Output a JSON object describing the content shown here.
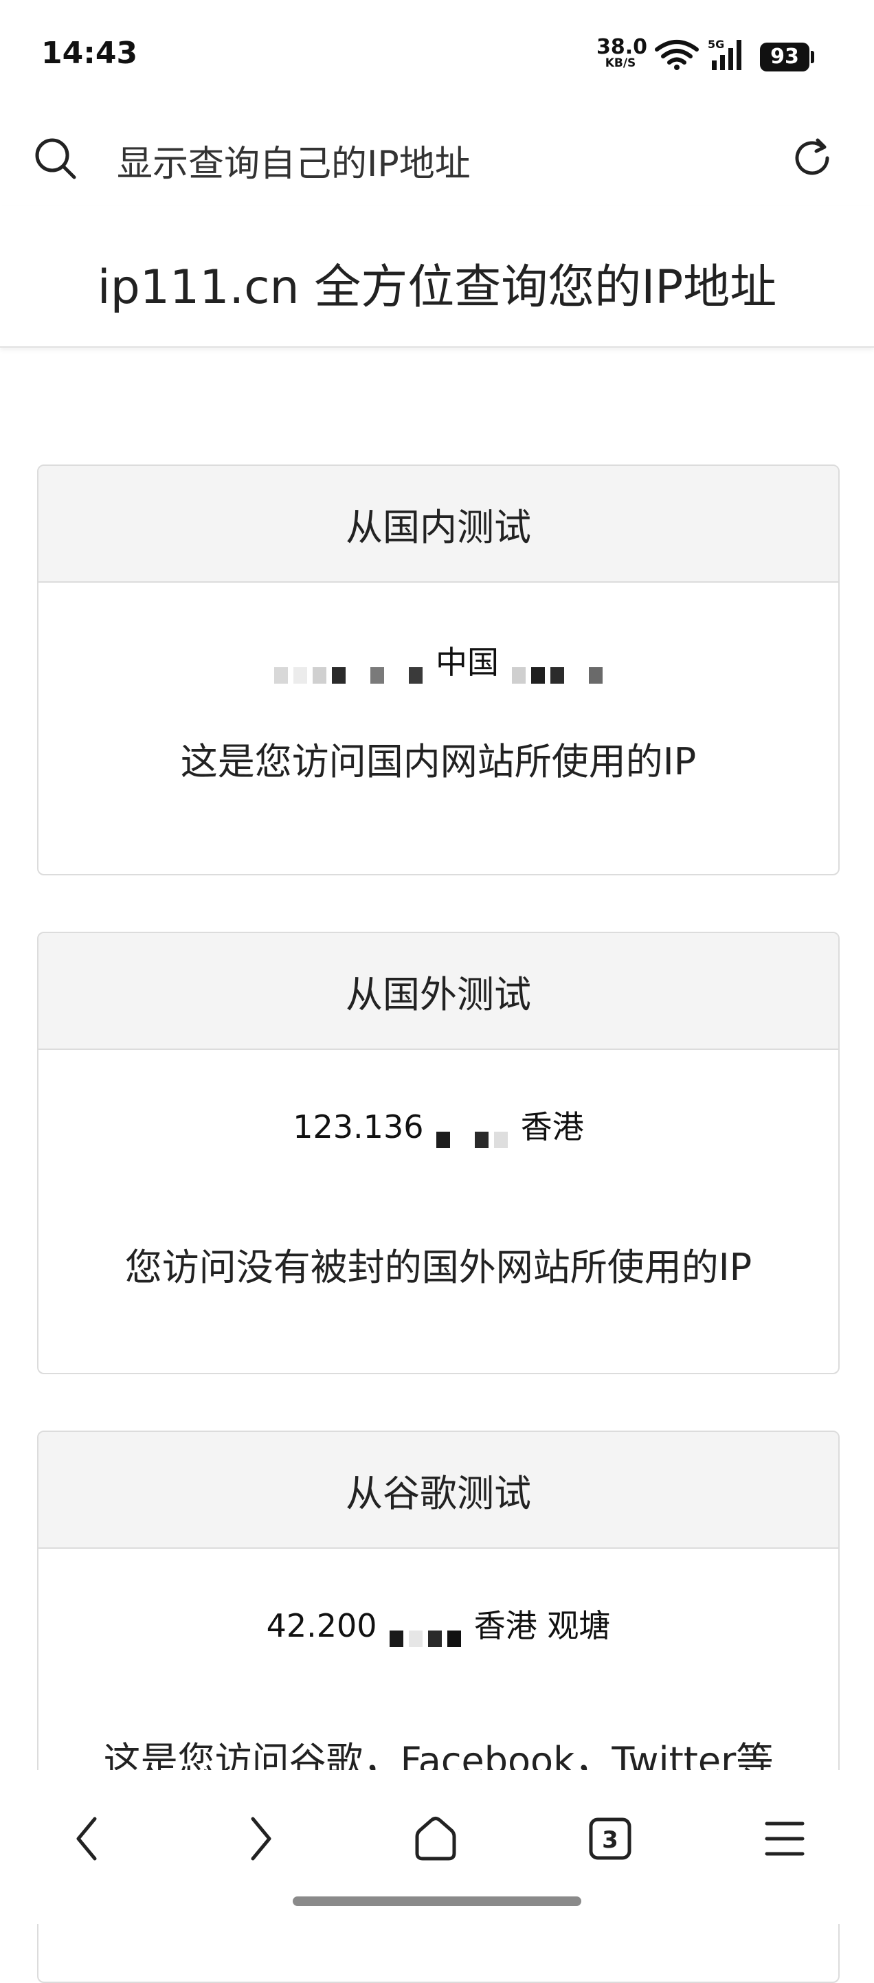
{
  "status_bar": {
    "time": "14:43",
    "net_speed_value": "38.0",
    "net_speed_unit": "KB/S",
    "network_type": "5G",
    "battery": "93"
  },
  "search": {
    "query": "显示查询自己的IP地址"
  },
  "header": {
    "title": "ip111.cn 全方位查询您的IP地址"
  },
  "cards": [
    {
      "title": "从国内测试",
      "ip_visible_text": "中国",
      "description": "这是您访问国内网站所使用的IP"
    },
    {
      "title": "从国外测试",
      "ip_visible_text_prefix": "123.136",
      "ip_visible_text_suffix": "香港",
      "description": "您访问没有被封的国外网站所使用的IP"
    },
    {
      "title": "从谷歌测试",
      "ip_visible_text_prefix": "42.200",
      "ip_visible_text_suffix": "香港 观塘",
      "description": "这是您访问谷歌，Facebook，Twitter等"
    }
  ],
  "bottom_nav": {
    "tab_count": "3"
  },
  "icons": {
    "search": "search-icon",
    "refresh": "refresh-icon",
    "back": "chevron-left-icon",
    "forward": "chevron-right-icon",
    "home": "home-icon",
    "tabs": "tabs-icon",
    "menu": "menu-icon"
  }
}
